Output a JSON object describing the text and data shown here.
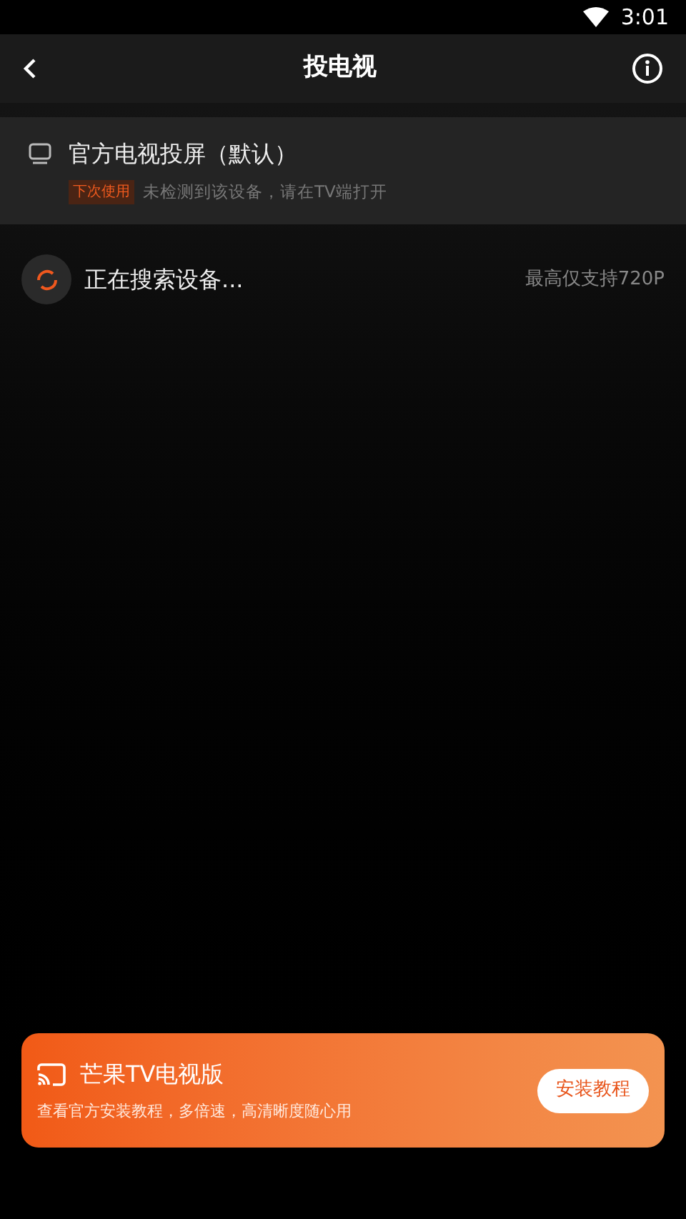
{
  "status_bar": {
    "time": "3:01"
  },
  "header": {
    "title": "投电视"
  },
  "default_device": {
    "name": "官方电视投屏（默认）",
    "tag": "下次使用",
    "hint": "未检测到该设备，请在TV端打开"
  },
  "search": {
    "status": "正在搜索设备...",
    "note": "最高仅支持720P"
  },
  "banner": {
    "title": "芒果TV电视版",
    "subtitle": "查看官方安装教程，多倍速，高清晰度随心用",
    "button": "安装教程"
  }
}
